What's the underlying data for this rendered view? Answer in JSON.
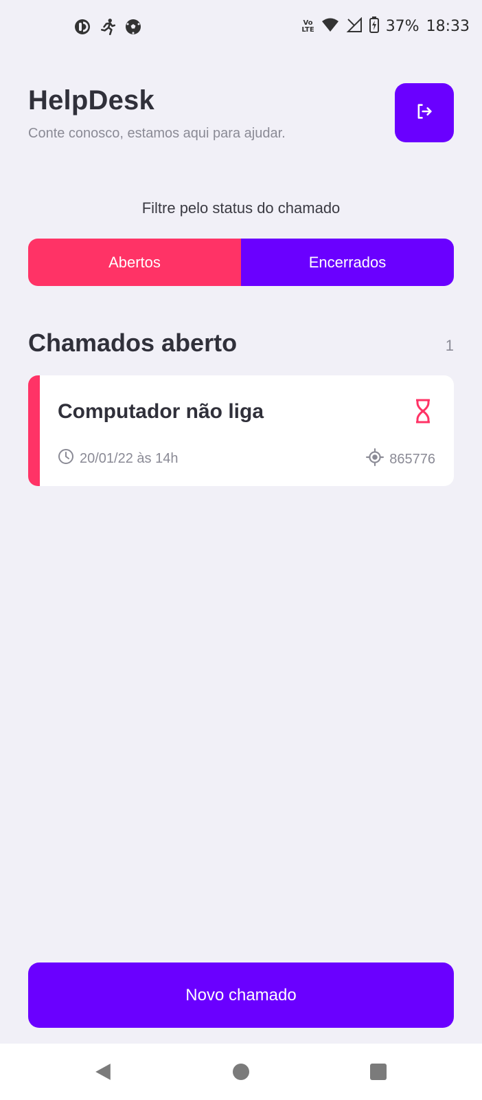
{
  "status_bar": {
    "left_icons": [
      "opera-icon",
      "running-person-icon",
      "soccer-ball-icon"
    ],
    "volte_label_top": "Vo",
    "volte_label_bottom": "LTE",
    "battery_percent": "37%",
    "time": "18:33"
  },
  "header": {
    "title": "HelpDesk",
    "subtitle": "Conte conosco, estamos aqui para ajudar.",
    "logout_icon": "logout-icon"
  },
  "filter": {
    "label": "Filtre pelo status do chamado",
    "options": [
      {
        "label": "Abertos",
        "color": "#FF3366"
      },
      {
        "label": "Encerrados",
        "color": "#6A00FF"
      }
    ]
  },
  "section": {
    "title": "Chamados aberto",
    "count": "1"
  },
  "tickets": [
    {
      "title": "Computador não liga",
      "date": "20/01/22 às 14h",
      "patrimony": "865776",
      "status_icon": "hourglass-icon",
      "accent_color": "#FF3366"
    }
  ],
  "actions": {
    "new_ticket_label": "Novo chamado"
  },
  "colors": {
    "primary": "#6A00FF",
    "secondary": "#FF3366",
    "background": "#F1F0F7"
  }
}
